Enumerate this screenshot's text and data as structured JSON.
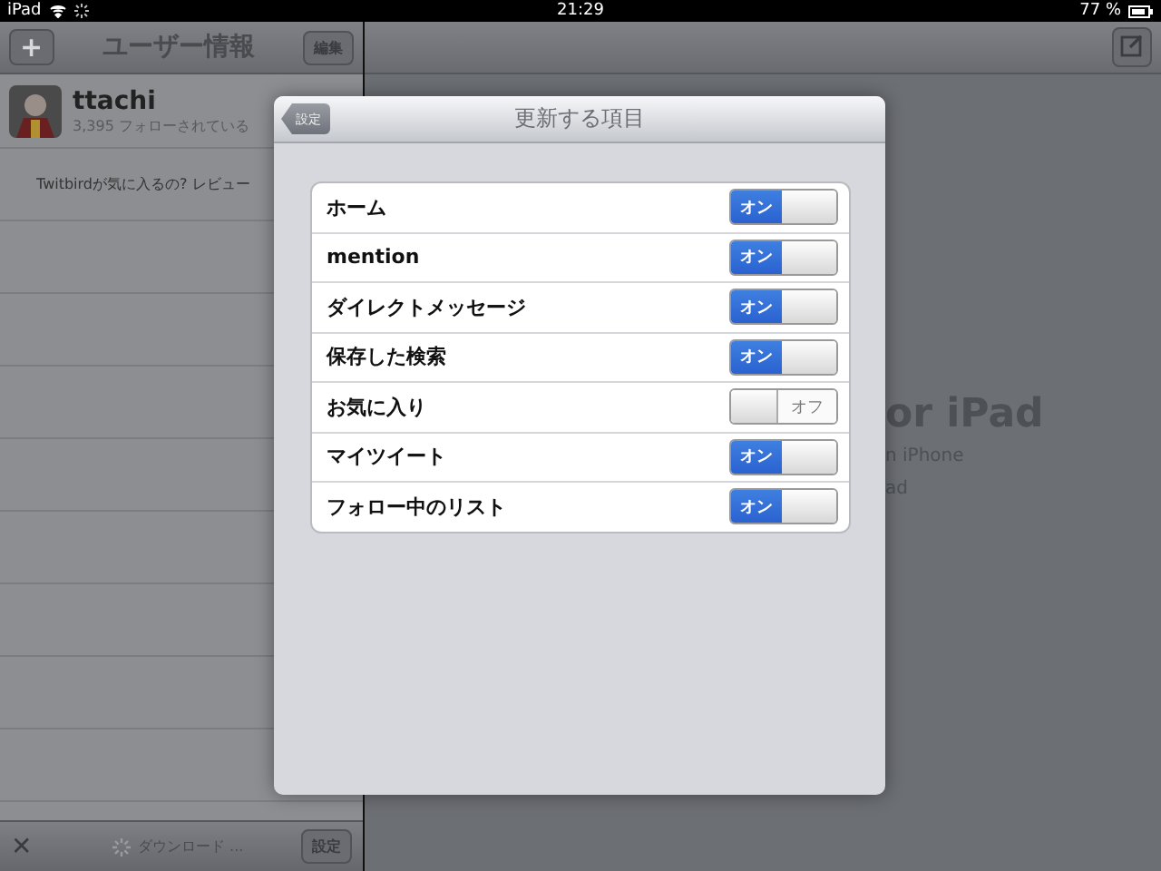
{
  "status_bar": {
    "device": "iPad",
    "time": "21:29",
    "battery": "77 %"
  },
  "left_pane": {
    "title": "ユーザー情報",
    "add_button": "+",
    "edit_button": "編集",
    "profile": {
      "name": "ttachi",
      "followers": "3,395 フォローされている"
    },
    "review_prompt": "Twitbirdが気に入るの? レビュー",
    "toolbar": {
      "close": "✕",
      "status": "ダウンロード ...",
      "settings_button": "設定"
    }
  },
  "right_pane": {
    "lines": [
      "or iPad",
      "n iPhone",
      "ad"
    ]
  },
  "modal": {
    "title": "更新する項目",
    "back_button": "設定",
    "items": [
      {
        "label": "ホーム",
        "on": true,
        "switch_text": "オン"
      },
      {
        "label": "mention",
        "on": true,
        "switch_text": "オン"
      },
      {
        "label": "ダイレクトメッセージ",
        "on": true,
        "switch_text": "オン"
      },
      {
        "label": "保存した検索",
        "on": true,
        "switch_text": "オン"
      },
      {
        "label": "お気に入り",
        "on": false,
        "switch_text": "オフ"
      },
      {
        "label": "マイツイート",
        "on": true,
        "switch_text": "オン"
      },
      {
        "label": "フォロー中のリスト",
        "on": true,
        "switch_text": "オン"
      }
    ]
  }
}
